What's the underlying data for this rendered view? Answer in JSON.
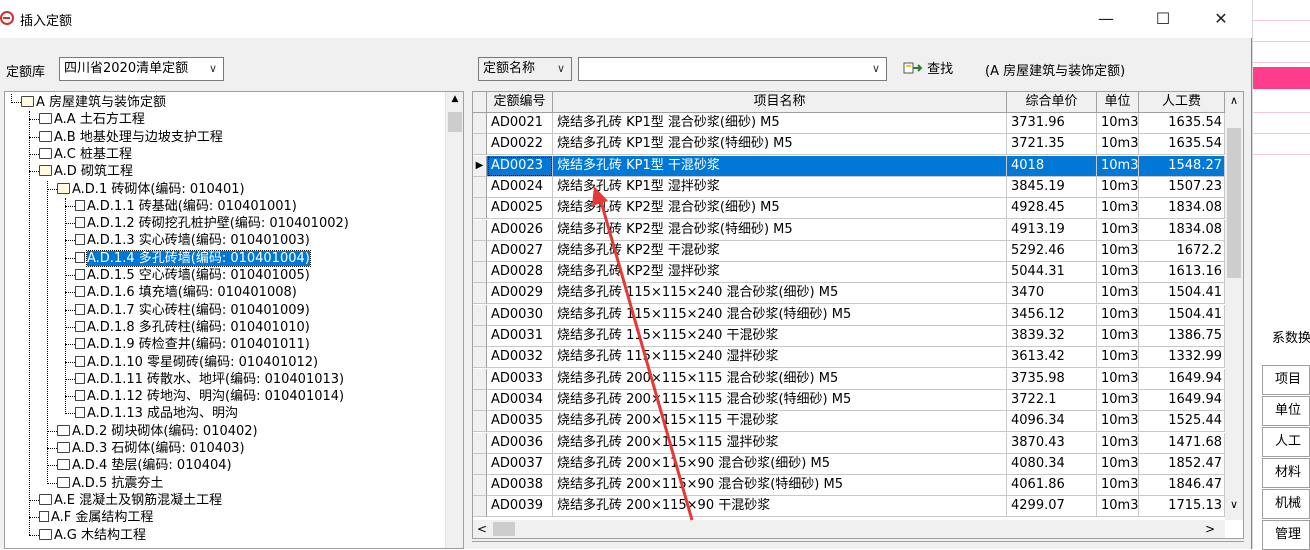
{
  "window": {
    "title": "插入定额",
    "minimize_icon": "minimize-icon",
    "maximize_icon": "maximize-icon",
    "close_icon": "close-icon"
  },
  "library": {
    "label": "定额库",
    "value": "四川省2020清单定额"
  },
  "search": {
    "field_select": "定额名称",
    "input_value": "",
    "find_label": "查找",
    "context_text": "(A 房屋建筑与装饰定额)"
  },
  "tree": [
    {
      "label": "A 房屋建筑与装饰定额",
      "type": "folder-open",
      "level": 0
    },
    {
      "label": "A.A 土石方工程",
      "type": "folder",
      "level": 1
    },
    {
      "label": "A.B 地基处理与边坡支护工程",
      "type": "folder",
      "level": 1
    },
    {
      "label": "A.C 桩基工程",
      "type": "folder",
      "level": 1
    },
    {
      "label": "A.D 砌筑工程",
      "type": "folder-open",
      "level": 1
    },
    {
      "label": "A.D.1 砖砌体(编码: 010401)",
      "type": "folder-open",
      "level": 2
    },
    {
      "label": "A.D.1.1 砖基础(编码: 010401001)",
      "type": "doc",
      "level": 3
    },
    {
      "label": "A.D.1.2 砖砌挖孔桩护壁(编码: 010401002)",
      "type": "doc",
      "level": 3
    },
    {
      "label": "A.D.1.3 实心砖墙(编码: 010401003)",
      "type": "doc",
      "level": 3
    },
    {
      "label": "A.D.1.4 多孔砖墙(编码: 010401004)",
      "type": "doc",
      "level": 3,
      "selected": true
    },
    {
      "label": "A.D.1.5 空心砖墙(编码: 010401005)",
      "type": "doc",
      "level": 3
    },
    {
      "label": "A.D.1.6 填充墙(编码: 010401008)",
      "type": "doc",
      "level": 3
    },
    {
      "label": "A.D.1.7 实心砖柱(编码: 010401009)",
      "type": "doc",
      "level": 3
    },
    {
      "label": "A.D.1.8 多孔砖柱(编码: 010401010)",
      "type": "doc",
      "level": 3
    },
    {
      "label": "A.D.1.9 砖检查井(编码: 010401011)",
      "type": "doc",
      "level": 3
    },
    {
      "label": "A.D.1.10 零星砌砖(编码: 010401012)",
      "type": "doc",
      "level": 3
    },
    {
      "label": "A.D.1.11 砖散水、地坪(编码: 010401013)",
      "type": "doc",
      "level": 3
    },
    {
      "label": "A.D.1.12 砖地沟、明沟(编码: 010401014)",
      "type": "doc",
      "level": 3
    },
    {
      "label": "A.D.1.13 成品地沟、明沟",
      "type": "doc",
      "level": 3
    },
    {
      "label": "A.D.2 砌块砌体(编码: 010402)",
      "type": "folder",
      "level": 2
    },
    {
      "label": "A.D.3 石砌体(编码: 010403)",
      "type": "folder",
      "level": 2
    },
    {
      "label": "A.D.4 垫层(编码: 010404)",
      "type": "folder",
      "level": 2
    },
    {
      "label": "A.D.5 抗震夯土",
      "type": "folder",
      "level": 2
    },
    {
      "label": "A.E 混凝土及钢筋混凝土工程",
      "type": "folder",
      "level": 1
    },
    {
      "label": "A.F 金属结构工程",
      "type": "doc",
      "level": 1
    },
    {
      "label": "A.G 木结构工程",
      "type": "folder",
      "level": 1
    }
  ],
  "grid": {
    "columns": [
      "定额编号",
      "项目名称",
      "综合单价",
      "单位",
      "人工费"
    ],
    "rows": [
      {
        "code": "AD0021",
        "name": "烧结多孔砖 KP1型 混合砂浆(细砂) M5",
        "price": "3731.96",
        "unit": "10m3",
        "labor": "1635.54"
      },
      {
        "code": "AD0022",
        "name": "烧结多孔砖 KP1型 混合砂浆(特细砂) M5",
        "price": "3721.35",
        "unit": "10m3",
        "labor": "1635.54"
      },
      {
        "code": "AD0023",
        "name": "烧结多孔砖 KP1型 干混砂浆",
        "price": "4018",
        "unit": "10m3",
        "labor": "1548.27",
        "selected": true
      },
      {
        "code": "AD0024",
        "name": "烧结多孔砖 KP1型 湿拌砂浆",
        "price": "3845.19",
        "unit": "10m3",
        "labor": "1507.23"
      },
      {
        "code": "AD0025",
        "name": "烧结多孔砖 KP2型 混合砂浆(细砂) M5",
        "price": "4928.45",
        "unit": "10m3",
        "labor": "1834.08"
      },
      {
        "code": "AD0026",
        "name": "烧结多孔砖 KP2型 混合砂浆(特细砂) M5",
        "price": "4913.19",
        "unit": "10m3",
        "labor": "1834.08"
      },
      {
        "code": "AD0027",
        "name": "烧结多孔砖 KP2型 干混砂浆",
        "price": "5292.46",
        "unit": "10m3",
        "labor": "1672.2"
      },
      {
        "code": "AD0028",
        "name": "烧结多孔砖 KP2型 湿拌砂浆",
        "price": "5044.31",
        "unit": "10m3",
        "labor": "1613.16"
      },
      {
        "code": "AD0029",
        "name": "烧结多孔砖 115×115×240 混合砂浆(细砂) M5",
        "price": "3470",
        "unit": "10m3",
        "labor": "1504.41"
      },
      {
        "code": "AD0030",
        "name": "烧结多孔砖 115×115×240 混合砂浆(特细砂) M5",
        "price": "3456.12",
        "unit": "10m3",
        "labor": "1504.41"
      },
      {
        "code": "AD0031",
        "name": "烧结多孔砖 115×115×240 干混砂浆",
        "price": "3839.32",
        "unit": "10m3",
        "labor": "1386.75"
      },
      {
        "code": "AD0032",
        "name": "烧结多孔砖 115×115×240 湿拌砂浆",
        "price": "3613.42",
        "unit": "10m3",
        "labor": "1332.99"
      },
      {
        "code": "AD0033",
        "name": "烧结多孔砖 200×115×115 混合砂浆(细砂) M5",
        "price": "3735.98",
        "unit": "10m3",
        "labor": "1649.94"
      },
      {
        "code": "AD0034",
        "name": "烧结多孔砖 200×115×115 混合砂浆(特细砂) M5",
        "price": "3722.1",
        "unit": "10m3",
        "labor": "1649.94"
      },
      {
        "code": "AD0035",
        "name": "烧结多孔砖 200×115×115 干混砂浆",
        "price": "4096.34",
        "unit": "10m3",
        "labor": "1525.44"
      },
      {
        "code": "AD0036",
        "name": "烧结多孔砖 200×115×115 湿拌砂浆",
        "price": "3870.43",
        "unit": "10m3",
        "labor": "1471.68"
      },
      {
        "code": "AD0037",
        "name": "烧结多孔砖 200×115×90 混合砂浆(细砂) M5",
        "price": "4080.34",
        "unit": "10m3",
        "labor": "1852.47"
      },
      {
        "code": "AD0038",
        "name": "烧结多孔砖 200×115×90 混合砂浆(特细砂) M5",
        "price": "4061.86",
        "unit": "10m3",
        "labor": "1846.47"
      },
      {
        "code": "AD0039",
        "name": "烧结多孔砖 200×115×90 干混砂浆",
        "price": "4299.07",
        "unit": "10m3",
        "labor": "1715.13"
      }
    ]
  },
  "background_panel": {
    "labels": [
      "系数换",
      "项目",
      "单位",
      "人工",
      "材料",
      "机械",
      "管理"
    ]
  },
  "colors": {
    "selection": "#0078d7",
    "annotation_arrow": "#e53935",
    "pink_accent": "#ff3d8a"
  }
}
